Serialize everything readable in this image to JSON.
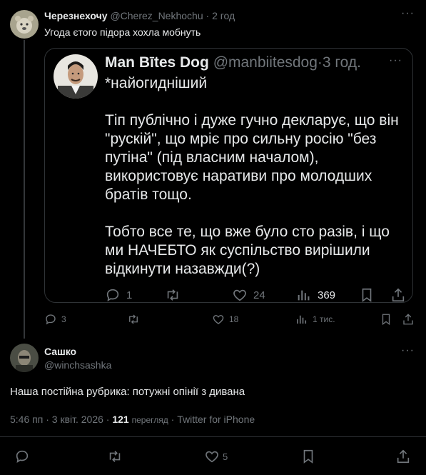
{
  "reply_tweet": {
    "display_name": "Черезнехочу",
    "handle": "@Cherez_Nekhochu",
    "separator": "·",
    "time": "2 год",
    "text": "Угода єтого підора хохла мобнуть",
    "more": "···",
    "stats": {
      "replies": "3",
      "retweets": "",
      "likes": "18",
      "views": "1 тис."
    }
  },
  "quoted_tweet": {
    "display_name": "Man Bītes Dog",
    "handle": "@manbiitesdog",
    "separator": "·",
    "time": "3 год.",
    "more": "···",
    "text": "*найогиднiший\n\nТiп публiчно i дуже гучно декларує, що вiн \"рускiй\", що мрiє про сильну росiю \"без путiна\" (пiд власним началом), використовує наративи про молодших братiв тощо.\n\nТобто все те, що вже було сто разiв, i що ми НАЧЕБТО як суспiльство вирiшили вiдкинути назавжди(?)",
    "stats": {
      "replies": "1",
      "retweets": "",
      "likes": "24",
      "views": "369"
    }
  },
  "main_tweet": {
    "display_name": "Сашко",
    "handle": "@winchsashka",
    "more": "···",
    "text": "Наша постійна рубрика: потужні опінії з дивана",
    "meta": {
      "time": "5:46 пп",
      "sep1": "·",
      "date": "3 квіт. 2026",
      "sep2": "·",
      "views_count": "121",
      "views_label": "перегляд",
      "sep3": "·",
      "source": "Twitter for iPhone"
    },
    "stats": {
      "replies": "",
      "retweets": "",
      "likes": "5"
    }
  },
  "colors": {
    "background": "#000000",
    "text": "#e7e9ea",
    "muted": "#71767b",
    "border": "#2f3336"
  }
}
